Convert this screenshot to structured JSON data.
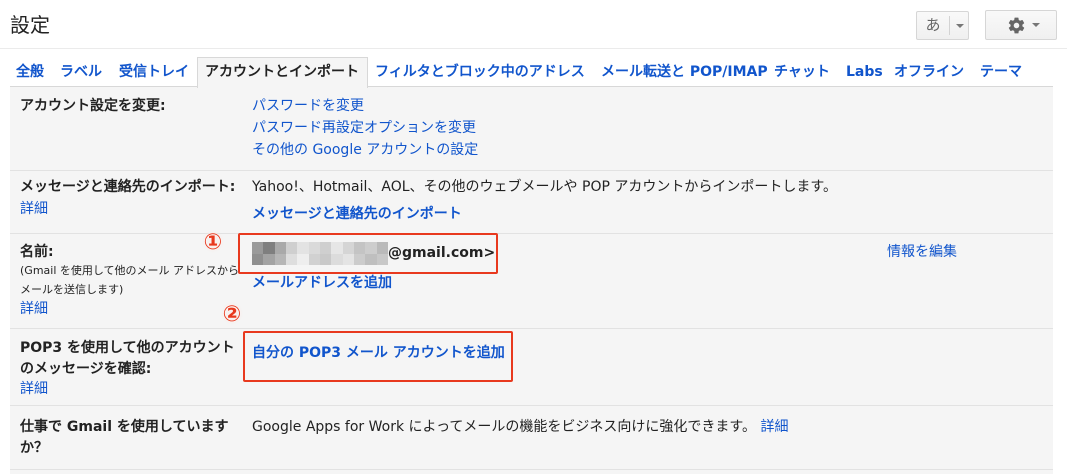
{
  "colors": {
    "link": "#1155cc",
    "text": "#222222",
    "annotation": "#e8391e",
    "panel_bg": "#f5f5f5",
    "divider": "#e2e2e2"
  },
  "header": {
    "title": "設定",
    "input_tools_label": "あ",
    "input_tools_menu_icon": "chevron-down-icon",
    "settings_icon": "gear-icon",
    "settings_menu_icon": "chevron-down-icon"
  },
  "tabs": [
    {
      "label": "全般",
      "selected": false
    },
    {
      "label": "ラベル",
      "selected": false
    },
    {
      "label": "受信トレイ",
      "selected": false
    },
    {
      "label": "アカウントとインポート",
      "selected": true
    },
    {
      "label": "フィルタとブロック中のアドレス",
      "selected": false
    },
    {
      "label": "メール転送と POP/IMAP",
      "selected": false
    },
    {
      "label": "チャット",
      "selected": false
    },
    {
      "label": "Labs",
      "selected": false
    },
    {
      "label": "オフライン",
      "selected": false
    },
    {
      "label": "テーマ",
      "selected": false
    }
  ],
  "settings": {
    "account": {
      "label": "アカウント設定を変更:",
      "links": [
        "パスワードを変更",
        "パスワード再設定オプションを変更",
        "その他の Google アカウントの設定"
      ]
    },
    "import": {
      "label": "メッセージと連絡先のインポート:",
      "learn_more": "詳細",
      "description": "Yahoo!、Hotmail、AOL、その他のウェブメールや POP アカウントからインポートします。",
      "action": "メッセージと連絡先のインポート"
    },
    "name": {
      "label": "名前:",
      "note_line1": "(Gmail を使用して他のメール アドレスから",
      "note_line2": "メールを送信します)",
      "learn_more": "詳細",
      "email_visible_part": "@gmail.com>",
      "add_address": "メールアドレスを追加",
      "edit_info": "情報を編集"
    },
    "pop3": {
      "label_line1": "POP3 を使用して他のアカウント",
      "label_line2": "のメッセージを確認:",
      "learn_more": "詳細",
      "add_account": "自分の POP3 メール アカウントを追加"
    },
    "work": {
      "label_line1": "仕事で Gmail を使用しています",
      "label_line2": "か？",
      "description": "Google Apps for Work によってメールの機能をビジネス向けに強化できます。",
      "learn_more": "詳細"
    }
  },
  "annotations": {
    "marker_1": "①",
    "marker_2": "②"
  }
}
